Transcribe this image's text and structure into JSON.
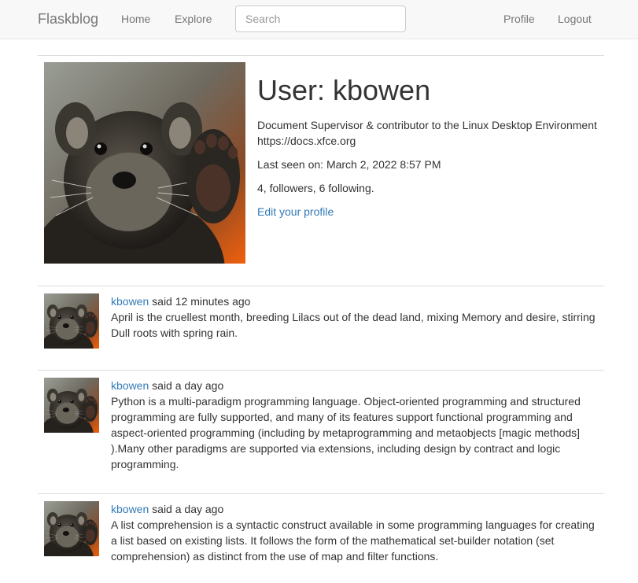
{
  "navbar": {
    "brand": "Flaskblog",
    "home": "Home",
    "explore": "Explore",
    "search_placeholder": "Search",
    "profile": "Profile",
    "logout": "Logout"
  },
  "profile": {
    "title": "User: kbowen",
    "about": "Document Supervisor & contributor to the Linux Desktop Environment https://docs.xfce.org",
    "last_seen": "Last seen on: March 2, 2022 8:57 PM",
    "follow_counts": "4, followers, 6 following.",
    "edit_link": "Edit your profile",
    "photo_icon": "binturong-photo"
  },
  "posts": [
    {
      "author": "kbowen",
      "meta": " said 12 minutes ago",
      "body": "April is the cruellest month, breeding Lilacs out of the dead land, mixing Memory and desire, stirring Dull roots with spring rain."
    },
    {
      "author": "kbowen",
      "meta": " said a day ago",
      "body": "Python is a multi-paradigm programming language. Object-oriented programming and structured programming are fully supported, and many of its features support functional programming and aspect-oriented programming (including by metaprogramming and metaobjects [magic methods] ).Many other paradigms are supported via extensions, including design by contract and logic programming."
    },
    {
      "author": "kbowen",
      "meta": " said a day ago",
      "body": "A list comprehension is a syntactic construct available in some programming languages for creating a list based on existing lists. It follows the form of the mathematical set-builder notation (set comprehension) as distinct from the use of map and filter functions."
    }
  ],
  "colors": {
    "link": "#337ab7",
    "navbar_bg": "#f8f8f8",
    "nav_text": "#777777"
  }
}
